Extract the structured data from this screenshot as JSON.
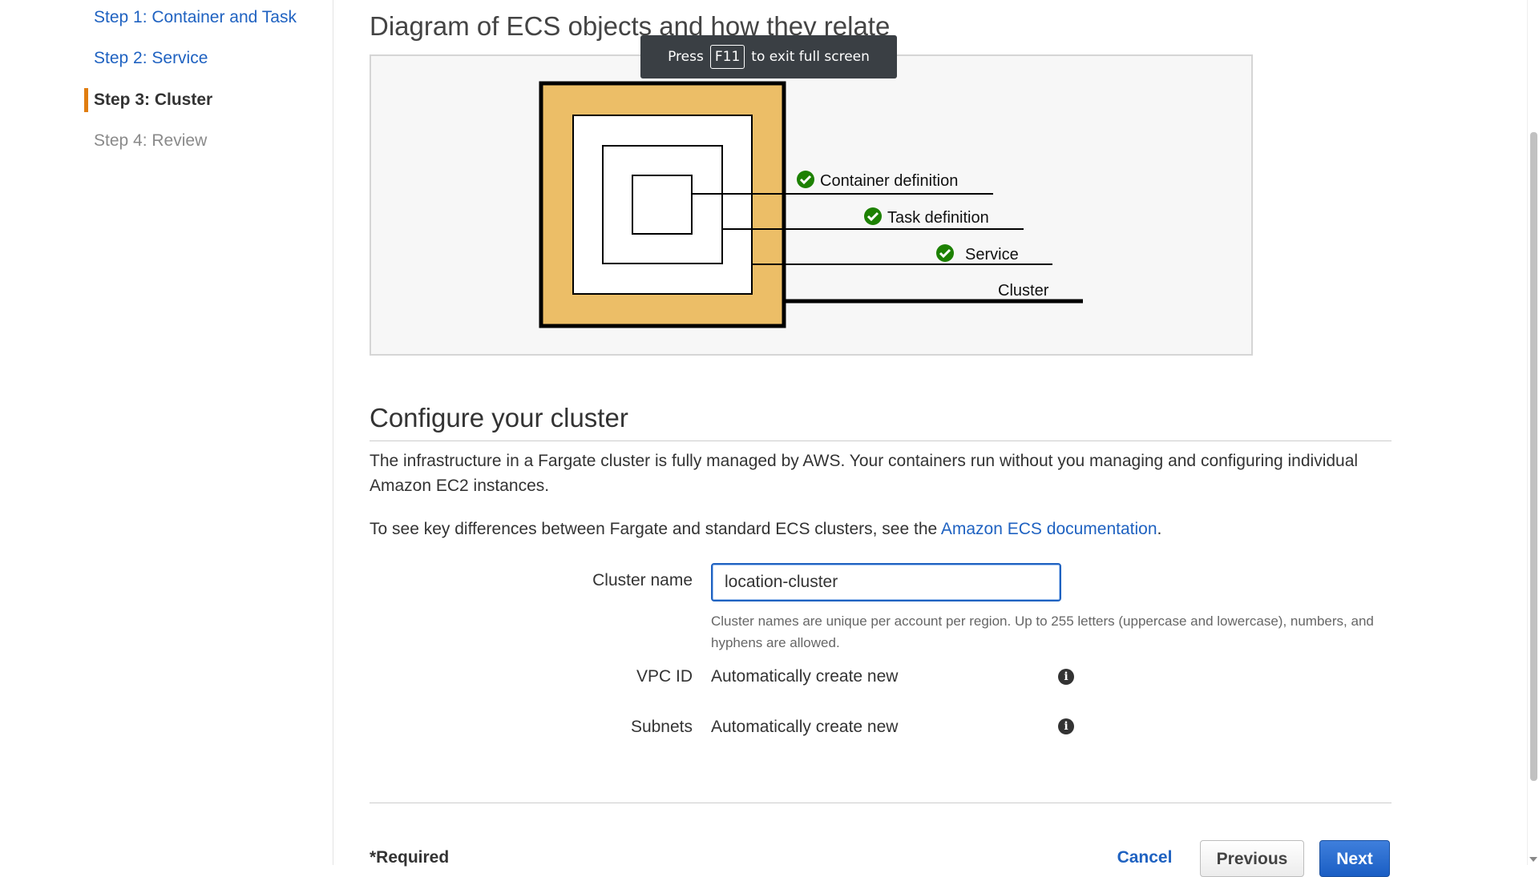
{
  "sidebar": {
    "steps": [
      {
        "label": "Step 1: Container and Task",
        "state": "link"
      },
      {
        "label": "Step 2: Service",
        "state": "link"
      },
      {
        "label": "Step 3: Cluster",
        "state": "active"
      },
      {
        "label": "Step 4: Review",
        "state": "disabled"
      }
    ],
    "active_marker_color": "#e07d10"
  },
  "diagram": {
    "title": "Diagram of ECS objects and how they relate",
    "items": [
      {
        "label": "Container definition",
        "checked": true
      },
      {
        "label": "Task definition",
        "checked": true
      },
      {
        "label": "Service",
        "checked": true
      },
      {
        "label": "Cluster",
        "checked": false
      }
    ],
    "cluster_fill_color": "#ecbe67",
    "check_color": "#1d8102"
  },
  "configure": {
    "title": "Configure your cluster",
    "description": "The infrastructure in a Fargate cluster is fully managed by AWS. Your containers run without you managing and configuring individual Amazon EC2 instances.",
    "docs_prefix": "To see key differences between Fargate and standard ECS clusters, see the ",
    "docs_link": "Amazon ECS documentation",
    "docs_suffix": ".",
    "cluster_name_label": "Cluster name",
    "cluster_name_value": "location-cluster",
    "cluster_name_hint": "Cluster names are unique per account per region. Up to 255 letters (uppercase and lowercase), numbers, and hyphens are allowed.",
    "vpc_label": "VPC ID",
    "vpc_value": "Automatically create new",
    "subnets_label": "Subnets",
    "subnets_value": "Automatically create new",
    "info_icon": "info-icon"
  },
  "footer": {
    "required": "*Required",
    "cancel": "Cancel",
    "previous": "Previous",
    "next": "Next"
  },
  "toast": {
    "prefix": "Press",
    "key": "F11",
    "suffix": "to exit full screen"
  },
  "colors": {
    "link": "#1f62c1",
    "primary_button": "#1a5ec4"
  }
}
